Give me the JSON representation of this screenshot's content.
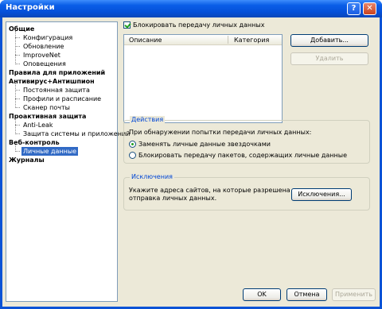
{
  "window": {
    "title": "Настройки",
    "help_label": "?",
    "close_label": "✕"
  },
  "nav": {
    "categories": [
      {
        "label": "Общие",
        "items": [
          "Конфигурация",
          "Обновление",
          "ImproveNet",
          "Оповещения"
        ]
      },
      {
        "label": "Правила для приложений",
        "items": []
      },
      {
        "label": "Антивирус+Антишпион",
        "items": [
          "Постоянная защита",
          "Профили и расписание",
          "Сканер почты"
        ]
      },
      {
        "label": "Проактивная защита",
        "items": [
          "Anti-Leak",
          "Защита системы и приложений"
        ]
      },
      {
        "label": "Веб-контроль",
        "items": [
          "Личные данные"
        ]
      },
      {
        "label": "Журналы",
        "items": []
      }
    ],
    "selected": "Личные данные"
  },
  "main": {
    "block_checkbox_label": "Блокировать передачу личных данных",
    "block_checked": true,
    "table": {
      "columns": [
        "Описание",
        "Категория"
      ],
      "rows": []
    },
    "add_button": "Добавить...",
    "delete_button": "Удалить",
    "actions": {
      "title": "Действия",
      "prompt": "При обнаружении попытки передачи личных данных:",
      "options": [
        "Заменять личные данные звездочками",
        "Блокировать передачу пакетов, содержащих личные данные"
      ],
      "selected_index": 0
    },
    "exceptions": {
      "title": "Исключения",
      "line1": "Укажите адреса сайтов, на которые разрешена",
      "line2": "отправка личных данных.",
      "button": "Исключения..."
    }
  },
  "footer": {
    "ok": "OK",
    "cancel": "Отмена",
    "apply": "Применить"
  },
  "colors": {
    "titlebar": "#0a5ee8",
    "selection": "#316ac5",
    "group_title": "#0046d5"
  }
}
